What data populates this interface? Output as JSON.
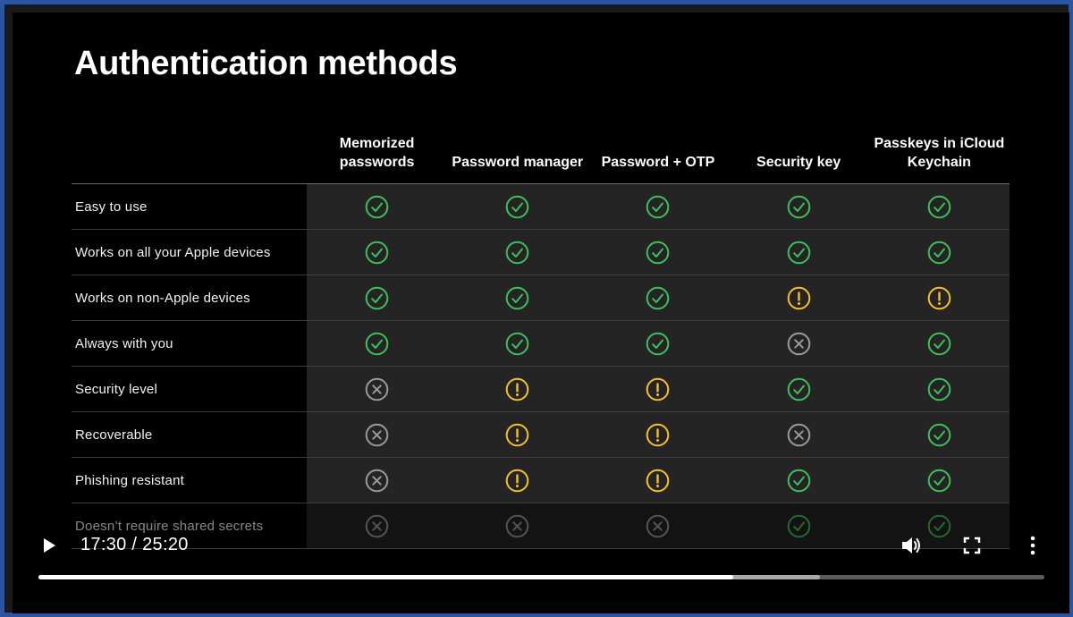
{
  "slide": {
    "title": "Authentication methods",
    "columns": [
      "Memorized passwords",
      "Password manager",
      "Password + OTP",
      "Security key",
      "Passkeys in iCloud Keychain"
    ],
    "rows": [
      {
        "label": "Easy to use",
        "status": [
          "check",
          "check",
          "check",
          "check",
          "check"
        ]
      },
      {
        "label": "Works on all your Apple devices",
        "status": [
          "check",
          "check",
          "check",
          "check",
          "check"
        ]
      },
      {
        "label": "Works on non-Apple devices",
        "status": [
          "check",
          "check",
          "check",
          "warning",
          "warning"
        ]
      },
      {
        "label": "Always with you",
        "status": [
          "check",
          "check",
          "check",
          "cross",
          "check"
        ]
      },
      {
        "label": "Security level",
        "status": [
          "cross",
          "warning",
          "warning",
          "check",
          "check"
        ]
      },
      {
        "label": "Recoverable",
        "status": [
          "cross",
          "warning",
          "warning",
          "cross",
          "check"
        ]
      },
      {
        "label": "Phishing resistant",
        "status": [
          "cross",
          "warning",
          "warning",
          "check",
          "check"
        ]
      },
      {
        "label": "Doesn’t require shared secrets",
        "status": [
          "cross",
          "cross",
          "cross",
          "check",
          "check"
        ]
      }
    ],
    "icons": {
      "check": {
        "name": "check-circle-icon",
        "color": "#3fbf5c"
      },
      "warning": {
        "name": "exclamation-circle-icon",
        "color": "#f5c02b"
      },
      "cross": {
        "name": "x-circle-icon",
        "color": "#9a9a9a"
      }
    }
  },
  "player": {
    "time_display": "17:30 / 25:20",
    "played_fraction": 0.6907,
    "buffered_fraction": 0.7769,
    "icons": {
      "play": "play-icon",
      "volume": "volume-icon",
      "fullscreen": "fullscreen-icon",
      "more": "more-vertical-icon"
    }
  }
}
